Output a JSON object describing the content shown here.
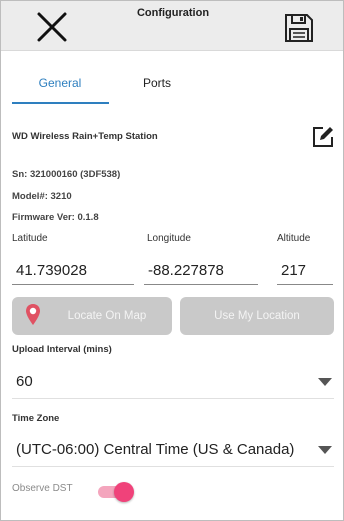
{
  "appbar": {
    "title": "Configuration",
    "close_icon": "close-icon",
    "save_icon": "floppy-disk-icon"
  },
  "tabs": [
    {
      "label": "General",
      "active": true
    },
    {
      "label": "Ports",
      "active": false
    }
  ],
  "station": {
    "name": "WD Wireless Rain+Temp Station",
    "edit_icon": "edit-icon",
    "sn": "Sn: 321000160 (3DF538)",
    "model": "Model#: 3210",
    "firmware": "Firmware Ver: 0.1.8"
  },
  "location": {
    "latitude_label": "Latitude",
    "longitude_label": "Longitude",
    "altitude_label": "Altitude",
    "latitude": "41.739028",
    "longitude": "-88.227878",
    "altitude": "217"
  },
  "buttons": {
    "locate_on_map": "Locate On Map",
    "use_my_location": "Use My Location",
    "pin_icon": "map-pin-icon"
  },
  "upload": {
    "label": "Upload Interval (mins)",
    "value": "60"
  },
  "timezone": {
    "label": "Time Zone",
    "value": "(UTC-06:00) Central Time (US & Canada)"
  },
  "dst": {
    "label": "Observe DST",
    "on": true
  },
  "colors": {
    "accent": "#2e7fbf",
    "toggle": "#f0427a",
    "pin": "#e05263",
    "button_disabled": "#c9c9c9"
  }
}
